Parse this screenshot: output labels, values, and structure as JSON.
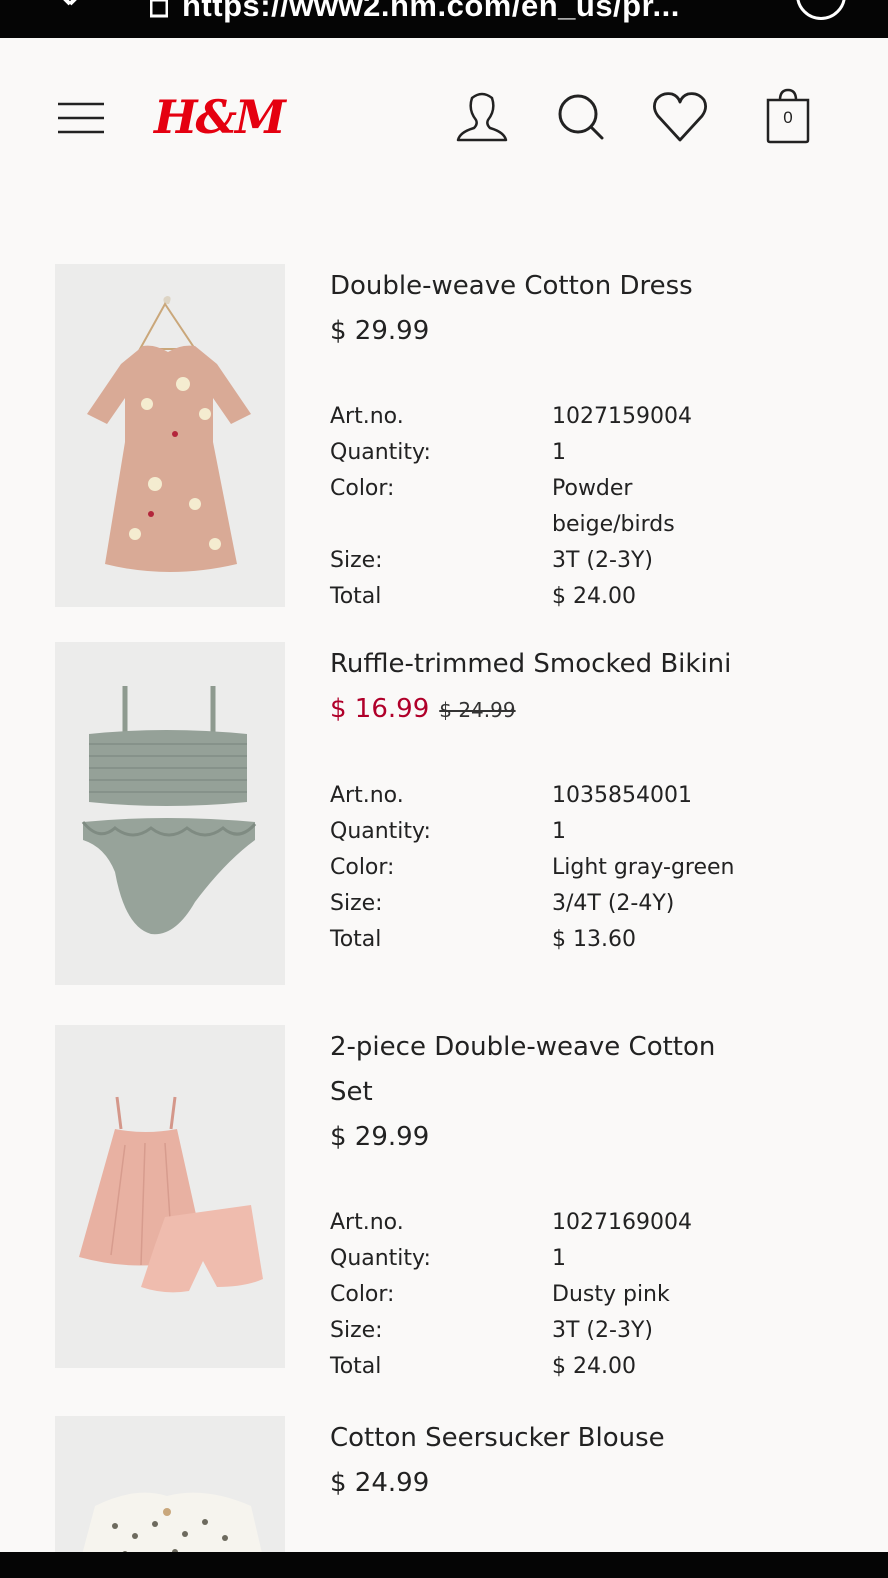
{
  "browser": {
    "url": "https://www2.hm.com/en_us/pr..."
  },
  "header": {
    "logo": "H&M",
    "bag_count": "0",
    "icons": [
      "menu-icon",
      "account-icon",
      "search-icon",
      "favorites-icon",
      "shopping-bag-icon"
    ]
  },
  "labels": {
    "art_no": "Art.no.",
    "quantity": "Quantity:",
    "color": "Color:",
    "size": "Size:",
    "total": "Total"
  },
  "products": [
    {
      "name": "Double-weave Cotton Dress",
      "price": "$ 29.99",
      "art_no": "1027159004",
      "quantity": "1",
      "color": "Powder beige/birds",
      "size": "3T (2-3Y)",
      "total": "$ 24.00"
    },
    {
      "name": "Ruffle-trimmed Smocked Bikini",
      "sale_price": "$ 16.99",
      "old_price": "$ 24.99",
      "art_no": "1035854001",
      "quantity": "1",
      "color": "Light gray-green",
      "size": "3/4T (2-4Y)",
      "total": "$ 13.60"
    },
    {
      "name": "2-piece Double-weave Cotton Set",
      "price": "$ 29.99",
      "art_no": "1027169004",
      "quantity": "1",
      "color": "Dusty pink",
      "size": "3T (2-3Y)",
      "total": "$ 24.00"
    },
    {
      "name": "Cotton Seersucker Blouse",
      "price": "$ 24.99"
    }
  ],
  "colors": {
    "brand": "#e50010",
    "sale": "#b0002a",
    "background": "#faf9f8"
  }
}
